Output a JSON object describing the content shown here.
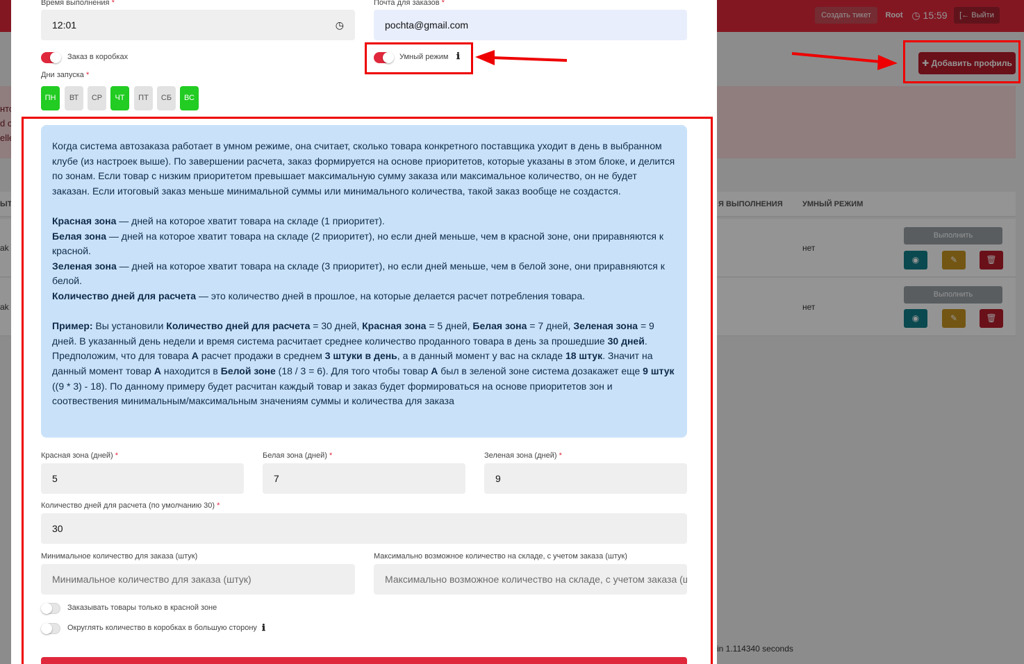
{
  "background": {
    "topbar": {
      "create_ticket": "Создать тикет",
      "user": "Root",
      "time": "15:59",
      "logout": "Выйти"
    },
    "add_profile": "Добавить профиль",
    "alert_fragments": [
      "нто",
      "d c",
      "elle"
    ],
    "table": {
      "headers": [
        "ЫТ",
        "Я ВЫПОЛНЕНИЯ",
        "УМНЫЙ РЕЖИМ"
      ],
      "rows": [
        {
          "prefix": "ak",
          "smart": "нет",
          "execute": "Выполнить"
        },
        {
          "prefix": "ak",
          "smart": "нет",
          "execute": "Выполнить"
        }
      ]
    },
    "footer": "in 1.114340 seconds"
  },
  "form": {
    "exec_time": {
      "label": "Время выполнения",
      "value": "12:01"
    },
    "email": {
      "label": "Почта для заказов",
      "value": "pochta@gmail.com"
    },
    "boxes_toggle": "Заказ в коробках",
    "smart_toggle": "Умный режим",
    "days_label": "Дни запуска",
    "days": [
      {
        "label": "ПН",
        "active": true
      },
      {
        "label": "ВТ",
        "active": false
      },
      {
        "label": "СР",
        "active": false
      },
      {
        "label": "ЧТ",
        "active": true
      },
      {
        "label": "ПТ",
        "active": false
      },
      {
        "label": "СБ",
        "active": false
      },
      {
        "label": "ВС",
        "active": true
      }
    ],
    "info": {
      "intro": "Когда система автозаказа работает в умном режиме, она считает, сколько товара конкретного поставщика уходит в день в выбранном клубе (из настроек выше). По завершении расчета, заказ формируется на основе приоритетов, которые указаны в этом блоке, и делится по зонам. Если товар с низким приоритетом превышает максимальную сумму заказа или максимальное количество, он не будет заказан. Если итоговый заказ меньше минимальной суммы или минимального количества, такой заказ вообще не создастся.",
      "red_b": "Красная зона",
      "red_t": " — дней на которое хватит товара на складе (1 приоритет).",
      "white_b": "Белая зона",
      "white_t": " — дней на которое хватит товара на складе (2 приоритет), но если дней меньше, чем в красной зоне, они приравняются к красной.",
      "green_b": "Зеленая зона",
      "green_t": " — дней на которое хватит товара на складе (3 приоритет), но если дней меньше, чем в белой зоне, они приравняются к белой.",
      "days_b": "Количество дней для расчета",
      "days_t": " — это количество дней в прошлое, на которые делается расчет потребления товара.",
      "ex": {
        "p1": "Пример:",
        "p2": " Вы установили ",
        "p3": "Количество дней для расчета",
        "p4": " = 30 дней, ",
        "p5": "Красная зона",
        "p6": " = 5 дней, ",
        "p7": "Белая зона",
        "p8": " = 7 дней, ",
        "p9": "Зеленая зона",
        "p10": " = 9 дней. В указанный день недели и время система расчитает среднее количество проданного товара в день за прошедшие ",
        "p11": "30 дней",
        "p12": ". Предположим, что для товара ",
        "p13": "А",
        "p14": " расчет продажи в среднем ",
        "p15": "3 штуки в день",
        "p16": ", а в данный момент у вас на складе ",
        "p17": "18 штук",
        "p18": ". Значит на данный момент товар ",
        "p19": "А",
        "p20": " находится в ",
        "p21": "Белой зоне",
        "p22": " (18 / 3 = 6). Для того чтобы товар ",
        "p23": "А",
        "p24": " был в зеленой зоне система дозакажет еще ",
        "p25": "9 штук",
        "p26": " ((9 * 3) - 18). По данному примеру будет расчитан каждый товар и заказ будет формироваться на основе приоритетов зон и соотвествения минимальным/максимальным значениям суммы и количества для заказа"
      }
    },
    "red_zone": {
      "label": "Красная зона (дней)",
      "value": "5"
    },
    "white_zone": {
      "label": "Белая зона (дней)",
      "value": "7"
    },
    "green_zone": {
      "label": "Зеленая зона (дней)",
      "value": "9"
    },
    "calc_days": {
      "label": "Количество дней для расчета (по умолчанию 30)",
      "value": "30"
    },
    "min_qty": {
      "label": "Минимальное количество для заказа (штук)",
      "placeholder": "Минимальное количество для заказа (штук)"
    },
    "max_qty": {
      "label": "Максимально возможное количество на складе, с учетом заказа (штук)",
      "placeholder": "Максимально возможное количество на складе, с учетом заказа (штук)"
    },
    "only_red_toggle": "Заказывать товары только в красной зоне",
    "round_boxes_toggle": "Округлять количество в коробках в большую сторону"
  },
  "icons": {
    "clock": "clock-icon",
    "info": "info-icon",
    "plus": "plus-icon",
    "eye": "eye-icon",
    "pencil": "pencil-icon",
    "trash": "trash-icon",
    "logout": "logout-icon"
  },
  "colors": {
    "primary": "#e0283c",
    "day_active": "#22cc22",
    "info_bg": "#c9e2f9",
    "annotation": "#ee0000"
  }
}
